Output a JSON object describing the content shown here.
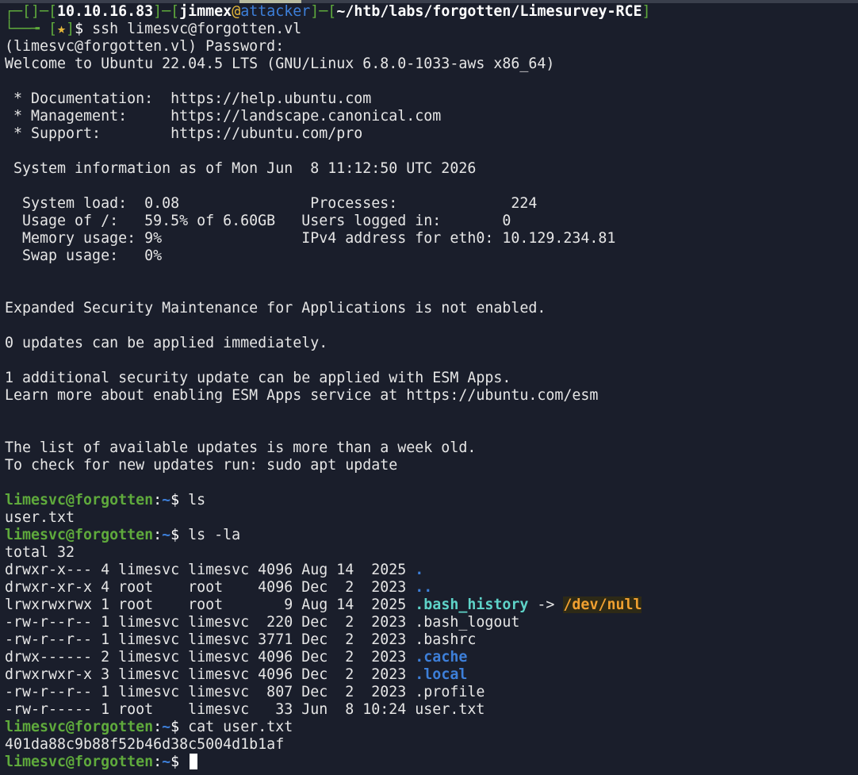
{
  "prompt_header": {
    "ip": "10.10.16.83",
    "user": "jimmex",
    "at": "@",
    "host": "attacker",
    "path": "~/htb/labs/forgotten/Limesurvey-RCE",
    "star": "★",
    "command": "ssh limesvc@forgotten.vl"
  },
  "output_lines": {
    "password": "(limesvc@forgotten.vl) Password:",
    "welcome": "Welcome to Ubuntu 22.04.5 LTS (GNU/Linux 6.8.0-1033-aws x86_64)",
    "doc": " * Documentation:  https://help.ubuntu.com",
    "mgmt": " * Management:     https://landscape.canonical.com",
    "support": " * Support:        https://ubuntu.com/pro",
    "sysinfo": " System information as of Mon Jun  8 11:12:50 UTC 2026",
    "load": "  System load:  0.08               Processes:             224",
    "usage": "  Usage of /:   59.5% of 6.60GB   Users logged in:       0",
    "memory": "  Memory usage: 9%                IPv4 address for eth0: 10.129.234.81",
    "swap": "  Swap usage:   0%",
    "esm": "Expanded Security Maintenance for Applications is not enabled.",
    "updates": "0 updates can be applied immediately.",
    "security": "1 additional security update can be applied with ESM Apps.",
    "learn": "Learn more about enabling ESM Apps service at https://ubuntu.com/esm",
    "list": "The list of available updates is more than a week old.",
    "check": "To check for new updates run: sudo apt update"
  },
  "shell": {
    "user_host": "limesvc@forgotten",
    "sep": ":",
    "path": "~",
    "dollar": "$ ",
    "cmd1": "ls",
    "out1": "user.txt",
    "cmd2": "ls -la",
    "total": "total 32",
    "cmd3": "cat user.txt",
    "flag": "401da88c9b88f52b46d38c5004d1b1af"
  },
  "listing": [
    {
      "meta": "drwxr-x--- 4 limesvc limesvc 4096 Aug 14  2025 ",
      "name": ".",
      "kind": "dir"
    },
    {
      "meta": "drwxr-xr-x 4 root    root    4096 Dec  2  2023 ",
      "name": "..",
      "kind": "dir"
    },
    {
      "meta": "lrwxrwxrwx 1 root    root       9 Aug 14  2025 ",
      "name": ".bash_history",
      "kind": "link",
      "arrow": " -> ",
      "target": "/dev/null"
    },
    {
      "meta": "-rw-r--r-- 1 limesvc limesvc  220 Dec  2  2023 ",
      "name": ".bash_logout",
      "kind": "file"
    },
    {
      "meta": "-rw-r--r-- 1 limesvc limesvc 3771 Dec  2  2023 ",
      "name": ".bashrc",
      "kind": "file"
    },
    {
      "meta": "drwx------ 2 limesvc limesvc 4096 Dec  2  2023 ",
      "name": ".cache",
      "kind": "dir"
    },
    {
      "meta": "drwxrwxr-x 3 limesvc limesvc 4096 Dec  2  2023 ",
      "name": ".local",
      "kind": "dir"
    },
    {
      "meta": "-rw-r--r-- 1 limesvc limesvc  807 Dec  2  2023 ",
      "name": ".profile",
      "kind": "file"
    },
    {
      "meta": "-rw-r----- 1 root    limesvc   33 Jun  8 10:24 ",
      "name": "user.txt",
      "kind": "file"
    }
  ],
  "colors": {
    "background": "#1a1e2b",
    "prompt_green": "#5faa3c",
    "dir_blue": "#3d7fd9",
    "link_cyan": "#5ed3c8",
    "target_orange": "#f0a030"
  }
}
